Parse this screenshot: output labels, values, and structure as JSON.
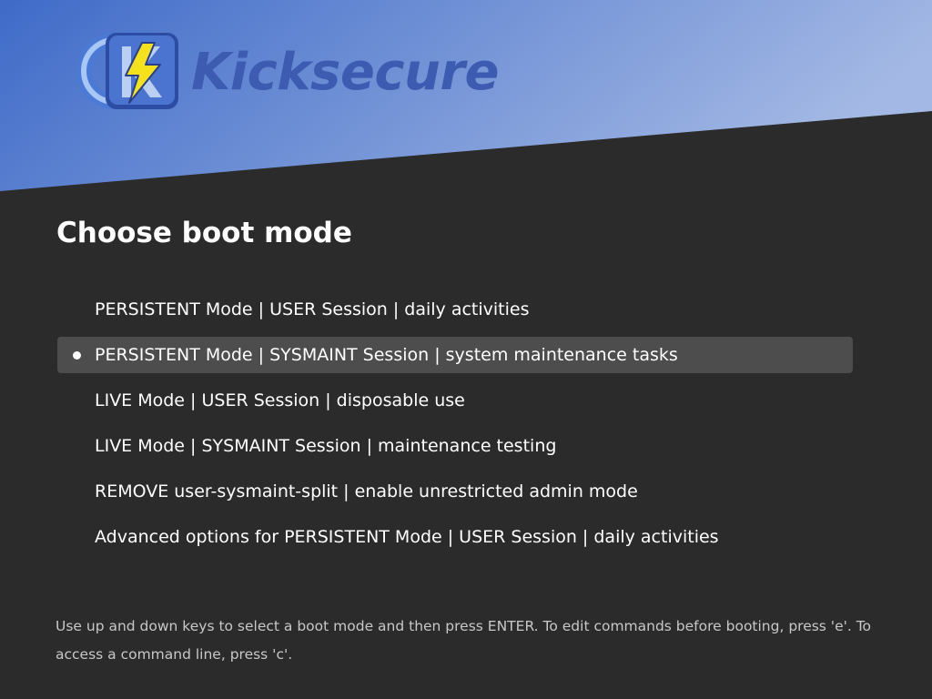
{
  "brand": {
    "name": "Kicksecure",
    "logo_icon": "kicksecure-logo-icon"
  },
  "colors": {
    "background": "#2b2b2b",
    "banner_gradient_start": "#3f6bc8",
    "banner_gradient_end": "#a3b8e4",
    "brand_text": "#3d5bb0",
    "selected_row": "#4d4d4d",
    "text": "#ffffff",
    "help_text": "#c8c8c8"
  },
  "boot_menu": {
    "title": "Choose boot mode",
    "items": [
      {
        "label": "PERSISTENT Mode | USER Session | daily activities",
        "selected": false
      },
      {
        "label": "PERSISTENT Mode | SYSMAINT Session | system maintenance tasks",
        "selected": true
      },
      {
        "label": "LIVE Mode | USER Session | disposable use",
        "selected": false
      },
      {
        "label": "LIVE Mode | SYSMAINT Session | maintenance testing",
        "selected": false
      },
      {
        "label": "REMOVE user-sysmaint-split | enable unrestricted admin mode",
        "selected": false
      },
      {
        "label": "Advanced options for PERSISTENT Mode | USER Session | daily activities",
        "selected": false
      }
    ],
    "help_text": "Use up and down keys to select a boot mode and then press ENTER. To edit commands before booting, press 'e'. To access a command line, press 'c'."
  }
}
